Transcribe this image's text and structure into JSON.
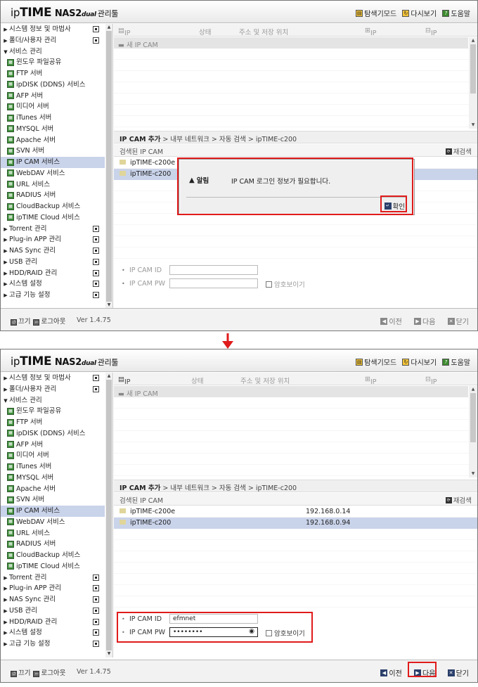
{
  "app": {
    "logo_ip": "ip",
    "logo_time": "TIME",
    "logo_nas": "NAS2",
    "logo_dual": "dual",
    "logo_tool": "관리툴"
  },
  "header_links": [
    {
      "label": "탐색기모드",
      "icon": "explorer-icon"
    },
    {
      "label": "다시보기",
      "icon": "refresh-icon"
    },
    {
      "label": "도움말",
      "icon": "help-icon"
    }
  ],
  "menu": [
    {
      "label": "시스템 정보 및 마법사",
      "type": "top",
      "icon": "info-icon"
    },
    {
      "label": "폴더/사용자 관리",
      "type": "top",
      "icon": "folder-user-icon"
    },
    {
      "label": "서비스 관리",
      "type": "open"
    },
    {
      "label": "윈도우 파일공유",
      "type": "sub"
    },
    {
      "label": "FTP 서버",
      "type": "sub"
    },
    {
      "label": "ipDISK (DDNS) 서비스",
      "type": "sub"
    },
    {
      "label": "AFP 서버",
      "type": "sub"
    },
    {
      "label": "미디어 서버",
      "type": "sub"
    },
    {
      "label": "iTunes 서버",
      "type": "sub"
    },
    {
      "label": "MYSQL 서버",
      "type": "sub"
    },
    {
      "label": "Apache 서버",
      "type": "sub"
    },
    {
      "label": "SVN 서버",
      "type": "sub"
    },
    {
      "label": "IP CAM 서비스",
      "type": "sub",
      "selected": true
    },
    {
      "label": "WebDAV 서비스",
      "type": "sub"
    },
    {
      "label": "URL 서비스",
      "type": "sub"
    },
    {
      "label": "RADIUS 서버",
      "type": "sub"
    },
    {
      "label": "CloudBackup 서비스",
      "type": "sub"
    },
    {
      "label": "ipTIME Cloud 서비스",
      "type": "sub"
    },
    {
      "label": "Torrent 관리",
      "type": "top",
      "icon": "torrent-icon"
    },
    {
      "label": "Plug-in APP 관리",
      "type": "top",
      "icon": "plugin-icon"
    },
    {
      "label": "NAS Sync 관리",
      "type": "top",
      "icon": "sync-icon"
    },
    {
      "label": "USB 관리",
      "type": "top",
      "icon": "usb-icon"
    },
    {
      "label": "HDD/RAID 관리",
      "type": "top",
      "icon": "hdd-icon"
    },
    {
      "label": "시스템 설정",
      "type": "top",
      "icon": "system-settings-icon"
    },
    {
      "label": "고급 기능 설정",
      "type": "top",
      "icon": "advanced-settings-icon"
    }
  ],
  "camlist": {
    "col_name": "IP CAM 이름",
    "col_status": "상태",
    "col_path": "주소 및 저장 위치",
    "add": "IP CAM 추가",
    "delete": "IP CAM 삭제",
    "new_row": "새 IP CAM"
  },
  "breadcrumb": {
    "bold": "IP CAM 추가",
    "rest": " > 내부 네트워크 > 자동 검색 > ipTIME-c200"
  },
  "detected": {
    "title": "검색된 IP CAM",
    "rescan": "재검색"
  },
  "devices1": [
    {
      "name": "ipTIME-c200e",
      "ip": ""
    },
    {
      "name": "ipTIME-c200",
      "ip": ""
    }
  ],
  "devices2": [
    {
      "name": "ipTIME-c200e",
      "ip": "192.168.0.14"
    },
    {
      "name": "ipTIME-c200",
      "ip": "192.168.0.94"
    }
  ],
  "form": {
    "id_label": "IP CAM ID",
    "pw_label": "IP CAM PW",
    "show_pw": "암호보이기",
    "id_value": "efmnet",
    "pw_value": "••••••••"
  },
  "dialog": {
    "title": "알림",
    "message": "IP CAM 로그인 정보가 필요합니다.",
    "ok": "확인"
  },
  "footer": {
    "off": "끄기",
    "logout": "로그아웃",
    "version": "Ver 1.4.75",
    "prev": "이전",
    "next": "다음",
    "close": "닫기"
  },
  "colors": {
    "highlight": "#e01b1b",
    "selected_row": "#c9d3ea"
  }
}
